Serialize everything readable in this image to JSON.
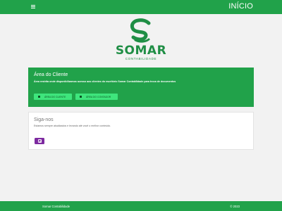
{
  "header": {
    "menu_icon": "hamburger-icon",
    "nav_label": "INÍCIO"
  },
  "brand": {
    "name": "SOMAR",
    "subtitle": "CONTABILIDADE",
    "logo_color": "#1f8e45"
  },
  "cliente": {
    "title": "Área do Cliente",
    "description": "Área restrita onde disponibilizamos acesso aos clientes do escritório Somar Contabilidade para troca de documentos",
    "buttons": [
      {
        "label": "ÁREA DO CLIENTE",
        "icon": "lock-icon"
      },
      {
        "label": "ÁREA DO CONTADOR",
        "icon": "lock-icon"
      }
    ]
  },
  "siga": {
    "title": "Siga-nos",
    "description": "Estamos sempre atualizados e levando até você o melhor conteúdo.",
    "social_icon": "instagram-icon"
  },
  "footer": {
    "left": "Somar Contabilidade",
    "right": "© 2023"
  },
  "colors": {
    "primary": "#21a24a",
    "button": "#3ee57c",
    "instagram": "#7d2aa0"
  }
}
